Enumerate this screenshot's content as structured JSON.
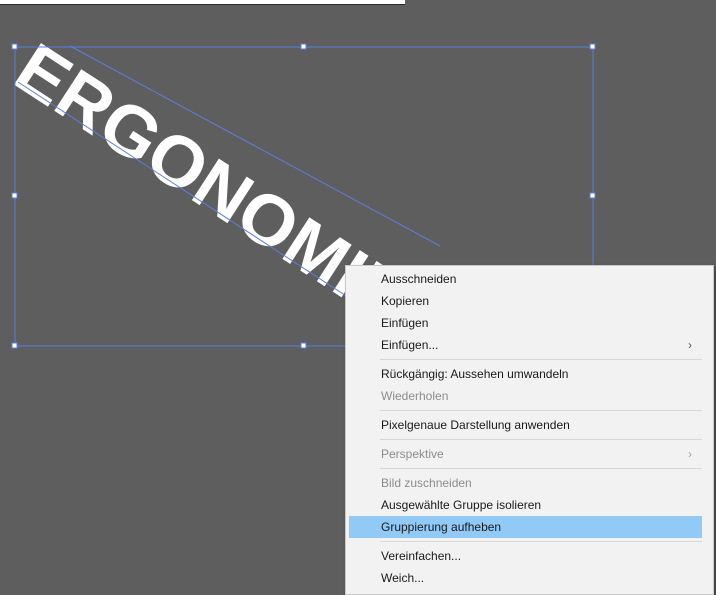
{
  "artwork": {
    "text": "ERGONOMIE",
    "text_color": "#ffffff",
    "selection_color": "#5b7fe0"
  },
  "context_menu": {
    "items": [
      {
        "label": "Ausschneiden",
        "enabled": true
      },
      {
        "label": "Kopieren",
        "enabled": true
      },
      {
        "label": "Einfügen",
        "enabled": true
      },
      {
        "label": "Einfügen...",
        "enabled": true,
        "submenu": true
      },
      {
        "label": "Rückgängig: Aussehen umwandeln",
        "enabled": true
      },
      {
        "label": "Wiederholen",
        "enabled": false
      },
      {
        "label": "Pixelgenaue Darstellung anwenden",
        "enabled": true
      },
      {
        "label": "Perspektive",
        "enabled": false,
        "submenu": true
      },
      {
        "label": "Bild zuschneiden",
        "enabled": false
      },
      {
        "label": "Ausgewählte Gruppe isolieren",
        "enabled": true
      },
      {
        "label": "Gruppierung aufheben",
        "enabled": true,
        "highlighted": true
      },
      {
        "label": "Vereinfachen...",
        "enabled": true
      },
      {
        "label": "Weich...",
        "enabled": true
      }
    ],
    "submenu_arrow": "›",
    "highlight_color": "#91c9f7"
  }
}
